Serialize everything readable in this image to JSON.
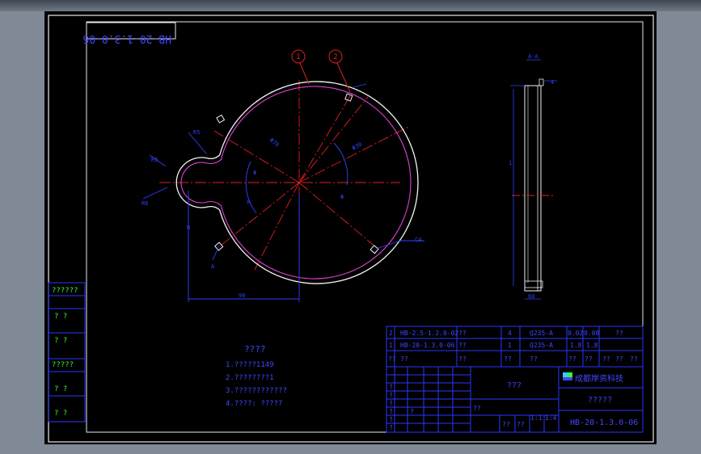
{
  "drawing": {
    "drawing_number_rotated": "HB-20-1.3.0-06",
    "balloons": [
      "1",
      "2"
    ],
    "section_label": "A-A",
    "section_marker": "A",
    "dims": {
      "d1": "R5",
      "d2": "R6",
      "d3": "Φ70",
      "d4": "Φ30",
      "d5": "R5",
      "d6": "Φ",
      "d7": "Φ",
      "d8": "8",
      "d9": "R",
      "d10": "90",
      "d11": "1",
      "d12": "4",
      "d13": "60",
      "leader_c": "C4"
    }
  },
  "notes": {
    "title": "????",
    "lines": [
      "1.?????1149",
      "2.????????1",
      "3.????????????",
      "4.????:  ?????"
    ]
  },
  "left_strip": [
    "??????",
    "?  ?",
    "?  ?",
    "?????",
    "?  ?",
    "?  ?"
  ],
  "parts_list": {
    "rows": [
      {
        "no": "2",
        "code": "HB-2.5-1.2.0-02",
        "name": "??",
        "qty": "4",
        "material": "Q235-A",
        "w1": "0.02",
        "w2": "0.08",
        "note": "??"
      },
      {
        "no": "1",
        "code": "HB-20-1.3.0-06",
        "name": "??",
        "qty": "1",
        "material": "Q235-A",
        "w1": "1.8",
        "w2": "1.8",
        "note": ""
      }
    ],
    "header": [
      "??",
      "??",
      "??",
      "??",
      "??",
      "??",
      "??",
      "??",
      "??",
      "??"
    ]
  },
  "title_block": {
    "part_name": "???",
    "company": "成都岸资科技",
    "drawing_title": "?????",
    "drawing_number": "HB-20-1.3.0-06",
    "cells": [
      "??",
      "??",
      "??",
      "1:1",
      "1:4"
    ],
    "small": [
      "?",
      "?",
      "?",
      "?",
      "?",
      "?",
      "?"
    ]
  }
}
